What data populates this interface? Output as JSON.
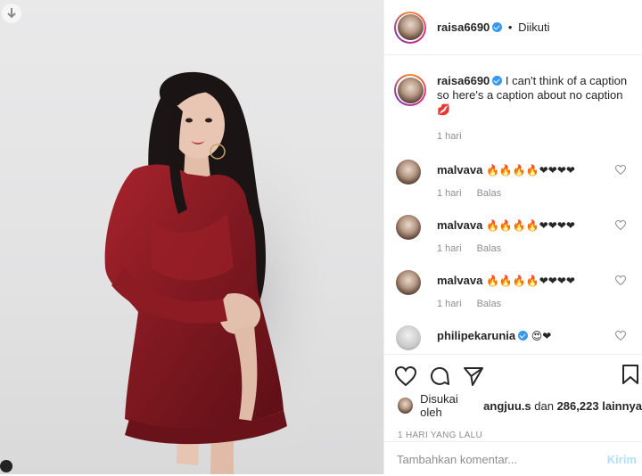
{
  "header": {
    "username": "raisa6690",
    "separator": "•",
    "follow_label": "Diikuti"
  },
  "caption": {
    "username": "raisa6690",
    "text": "I can't think of a caption so here's a caption about no caption",
    "emoji": "💋",
    "time": "1 hari"
  },
  "comments": [
    {
      "username": "malvava",
      "emoji": "🔥🔥🔥🔥❤❤❤❤",
      "time": "1 hari",
      "reply": "Balas"
    },
    {
      "username": "malvava",
      "emoji": "🔥🔥🔥🔥❤❤❤❤",
      "time": "1 hari",
      "reply": "Balas"
    },
    {
      "username": "malvava",
      "emoji": "🔥🔥🔥🔥❤❤❤❤",
      "time": "1 hari",
      "reply": "Balas"
    },
    {
      "username": "philipekarunia",
      "emoji": "😍❤",
      "verified": true
    }
  ],
  "likes": {
    "prefix": "Disukai oleh",
    "user": "angjuu.s",
    "mid": "dan",
    "count": "286,223",
    "suffix": "lainnya"
  },
  "date": "1 HARI YANG LALU",
  "add_comment": {
    "placeholder": "Tambahkan komentar...",
    "post_label": "Kirim"
  },
  "icons": [
    "download-icon",
    "heart-icon",
    "comment-icon",
    "share-icon",
    "bookmark-icon",
    "verified-icon"
  ],
  "colors": {
    "verified": "#3897f0",
    "muted": "#8e8e8e",
    "post_disabled": "#b2dffc",
    "dress": "#8b1a22"
  }
}
